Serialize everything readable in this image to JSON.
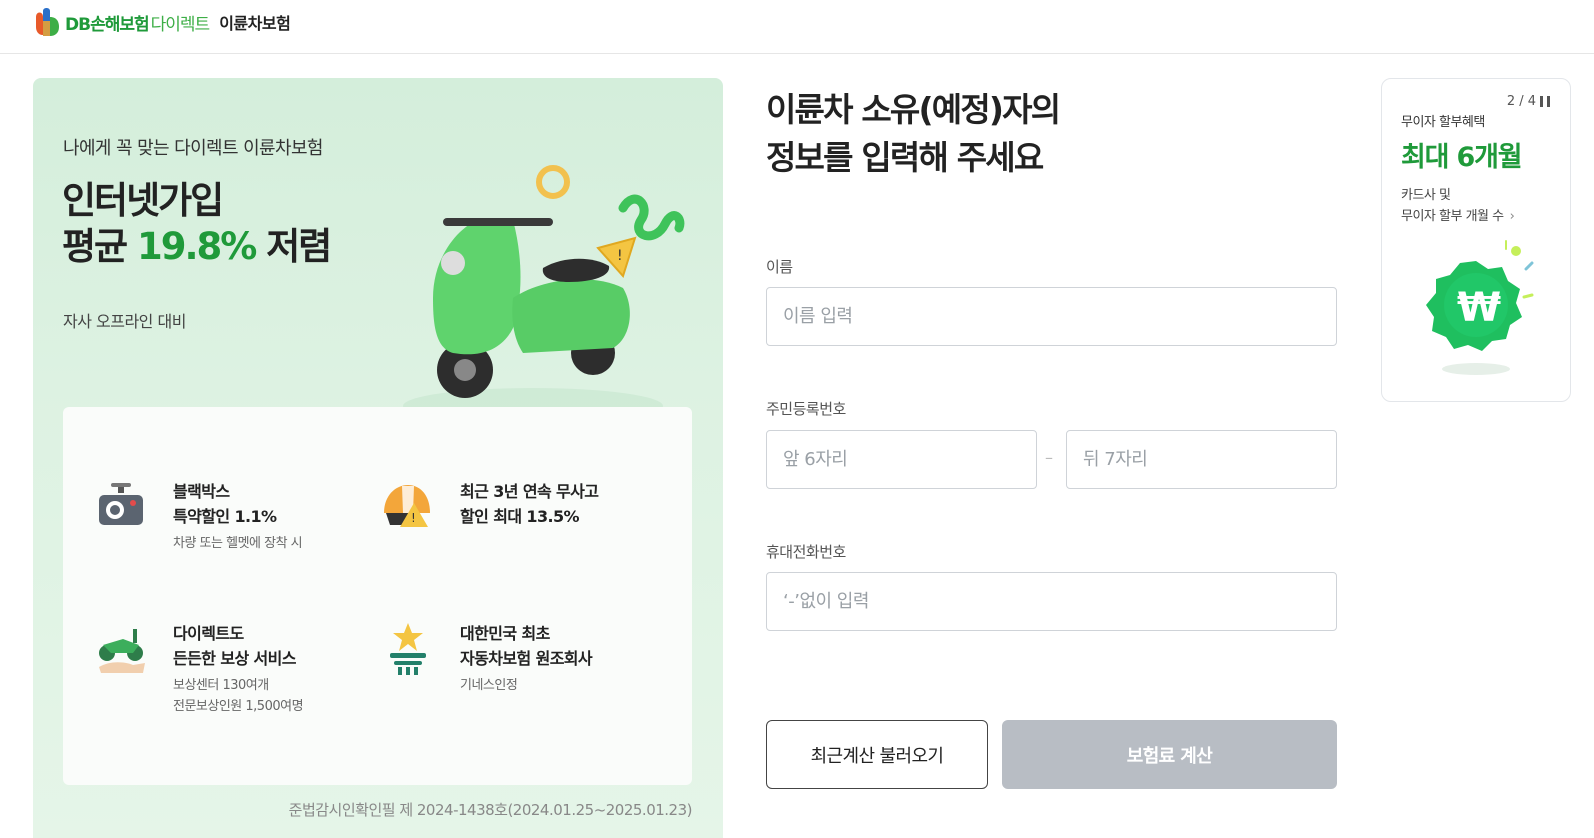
{
  "header": {
    "brand_db": "DB손해보험",
    "brand_direct": "다이렉트",
    "product": "이륜차보험"
  },
  "promo": {
    "subtitle": "나에게 꼭 맞는 다이렉트 이륜차보험",
    "title_line1": "인터넷가입",
    "title_prefix": "평균 ",
    "title_percent": "19.8%",
    "title_suffix": " 저렴",
    "note": "자사 오프라인 대비",
    "benefits": [
      {
        "icon": "dashcam-icon",
        "title": "블랙박스\n특약할인 1.1%",
        "desc": "차량 또는 헬멧에 장착 시"
      },
      {
        "icon": "helmet-warning-icon",
        "title": "최근 3년 연속 무사고\n할인 최대 13.5%",
        "desc": ""
      },
      {
        "icon": "scooter-hand-icon",
        "title": "다이렉트도\n든든한 보상 서비스",
        "desc": "보상센터 130여개\n전문보상인원 1,500여명"
      },
      {
        "icon": "star-trophy-icon",
        "title": "대한민국 최초\n자동차보험 원조회사",
        "desc": "기네스인정"
      }
    ],
    "legal": "준법감시인확인필 제 2024-1438호(2024.01.25~2025.01.23)"
  },
  "form": {
    "title": "이륜차 소유(예정)자의\n정보를 입력해 주세요",
    "name_label": "이름",
    "name_placeholder": "이름 입력",
    "rrn_label": "주민등록번호",
    "rrn_front_placeholder": "앞 6자리",
    "rrn_separator": "–",
    "rrn_back_placeholder": "뒤 7자리",
    "phone_label": "휴대전화번호",
    "phone_placeholder": "‘-’없이 입력",
    "recent_button": "최근계산 불러오기",
    "calc_button": "보험료 계산"
  },
  "side_banner": {
    "pager": "2 / 4",
    "subtitle": "무이자 할부혜택",
    "headline": "최대 6개월",
    "desc_line1": "카드사 및",
    "desc_line2": "무이자 할부 개월 수"
  },
  "colors": {
    "brand_green": "#1f9a3a",
    "promo_bg": "#d4eedb",
    "disabled_button": "#b8bdc4"
  }
}
